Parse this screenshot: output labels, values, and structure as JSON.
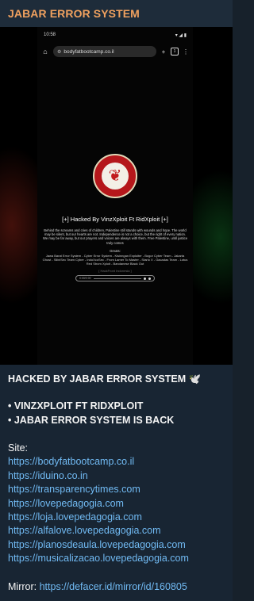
{
  "channel": {
    "name": "JABAR ERROR SYSTEM"
  },
  "screenshot": {
    "status_time": "10:58",
    "status_right": "▾ ◢ ▮",
    "url": "bodyfatbootcamp.co.il",
    "tab_count": "1",
    "emblem_text": "JAWA BARAT ERROR SYSTEM · FOR CYBER TO SECURITY",
    "title": "[+] Hacked By VinzXploit Ft RidXploit [+]",
    "paragraph": "Behind the screams and cries of children, Palestine still stands with wounds and hope. The world may be silent, but our hearts are not. Independence is not a choice, but the right of every nation. We may be far away, but our prayers and voices are always with them. Free Palestine, until justice truly comes",
    "greets_label": "Greats:",
    "teams": "Jawa Barat Error System - Cyber Error System - Kisinngan Exploiter - Bogor Cyber Team - Jakarta Ghost - SiliniSec Team Cyber - IndoXcoSec - From Lamer To Master - Starlo X - Gacadas Team - Lotus Red Strom Xploit - Bandanese Black Out",
    "nickname": "[ HackFront Indonesia ]",
    "player_time": "0:00/0:00"
  },
  "caption": {
    "headline": "HACKED BY JABAR ERROR SYSTEM 🕊️",
    "bullet1": "• VINZXPLOIT FT RIDXPLOIT",
    "bullet2": "• JABAR ERROR SYSTEM IS BACK",
    "site_label": "Site:",
    "sites": [
      "https://bodyfatbootcamp.co.il",
      "https://iduino.co.in",
      "https://transparencytimes.com",
      "https://lovepedagogia.com",
      "https://loja.lovepedagogia.com",
      "https://alfalove.lovepedagogia.com",
      "https://planosdeaula.lovepedagogia.com",
      "https://musicalizacao.lovepedagogia.com"
    ],
    "mirror_label": "Mirror:",
    "mirror_url": "https://defacer.id/mirror/id/160805"
  },
  "colors": {
    "accent": "#f0a15f",
    "link": "#71baf3",
    "background": "#182533"
  }
}
